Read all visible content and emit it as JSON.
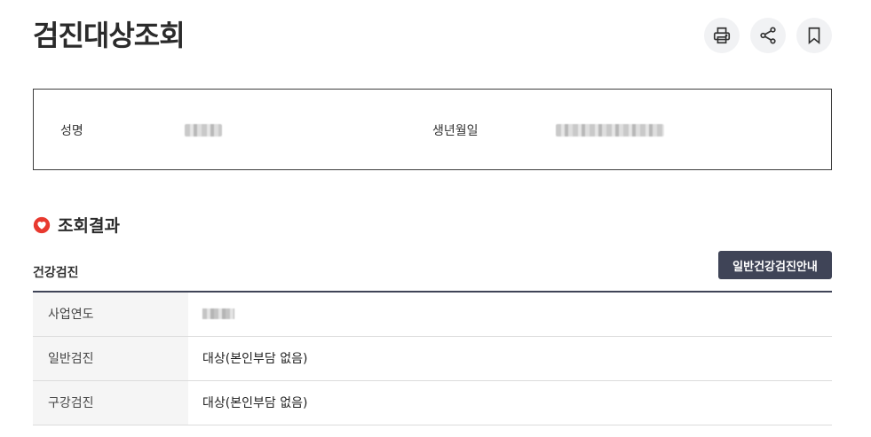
{
  "header": {
    "title": "검진대상조회",
    "actions": [
      {
        "name": "print",
        "icon": "printer-icon"
      },
      {
        "name": "share",
        "icon": "share-icon"
      },
      {
        "name": "bookmark",
        "icon": "bookmark-icon"
      }
    ]
  },
  "info": {
    "name_label": "성명",
    "birth_label": "생년월일"
  },
  "result": {
    "section_title": "조회결과",
    "section_icon": "heart-icon",
    "subtitle": "건강검진",
    "guide_button": "일반건강검진안내",
    "rows": [
      {
        "label": "사업연도",
        "value": ""
      },
      {
        "label": "일반검진",
        "value": "대상(본인부담 없음)"
      },
      {
        "label": "구강검진",
        "value": "대상(본인부담 없음)"
      }
    ]
  },
  "colors": {
    "accent": "#3f4457",
    "heart": "#e8392f",
    "button_bg": "#f1f2f4"
  }
}
